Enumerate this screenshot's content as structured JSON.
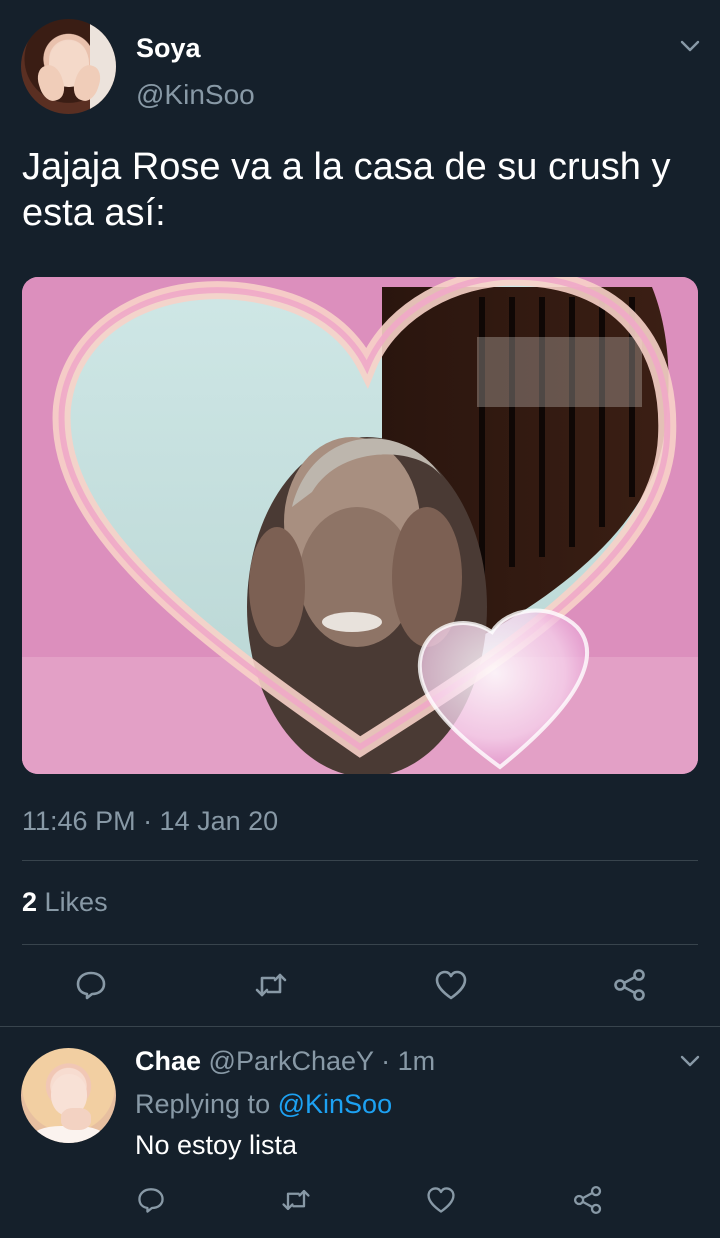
{
  "tweet": {
    "display_name": "Soya",
    "handle": "@KinSoo",
    "text": "Jajaja Rose va a la casa de su crush y esta así:",
    "timestamp": "11:46 PM · 14 Jan 20",
    "likes_count": "2",
    "likes_label": "Likes",
    "menu_icon": "chevron-down-icon"
  },
  "actions": [
    "reply-icon",
    "retweet-icon",
    "like-icon",
    "share-icon"
  ],
  "reply": {
    "display_name": "Chae",
    "handle": "@ParkChaeY",
    "separator": "·",
    "time": "1m",
    "replying_to_label": "Replying to",
    "replying_to_handle": "@KinSoo",
    "text": "No estoy lista"
  },
  "colors": {
    "background": "#15202b",
    "secondary_text": "#8899a6",
    "divider": "#38444d",
    "accent": "#1da1f2"
  }
}
